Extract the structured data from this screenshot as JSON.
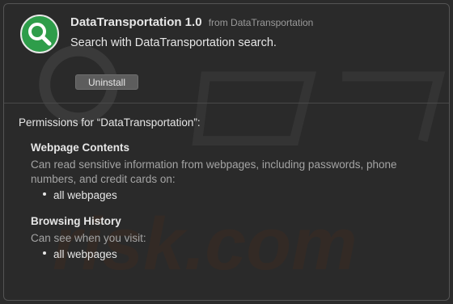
{
  "extension": {
    "name": "DataTransportation 1.0",
    "from": "from DataTransportation",
    "description": "Search with DataTransportation search.",
    "icon": "magnifier-icon",
    "icon_color": "#2e9d4a"
  },
  "buttons": {
    "uninstall": "Uninstall"
  },
  "permissions": {
    "heading": "Permissions for “DataTransportation”:",
    "sections": [
      {
        "title": "Webpage Contents",
        "description": "Can read sensitive information from webpages, including passwords, phone numbers, and credit cards on:",
        "items": [
          "all webpages"
        ]
      },
      {
        "title": "Browsing History",
        "description": "Can see when you visit:",
        "items": [
          "all webpages"
        ]
      }
    ]
  },
  "watermark": "risk.com"
}
